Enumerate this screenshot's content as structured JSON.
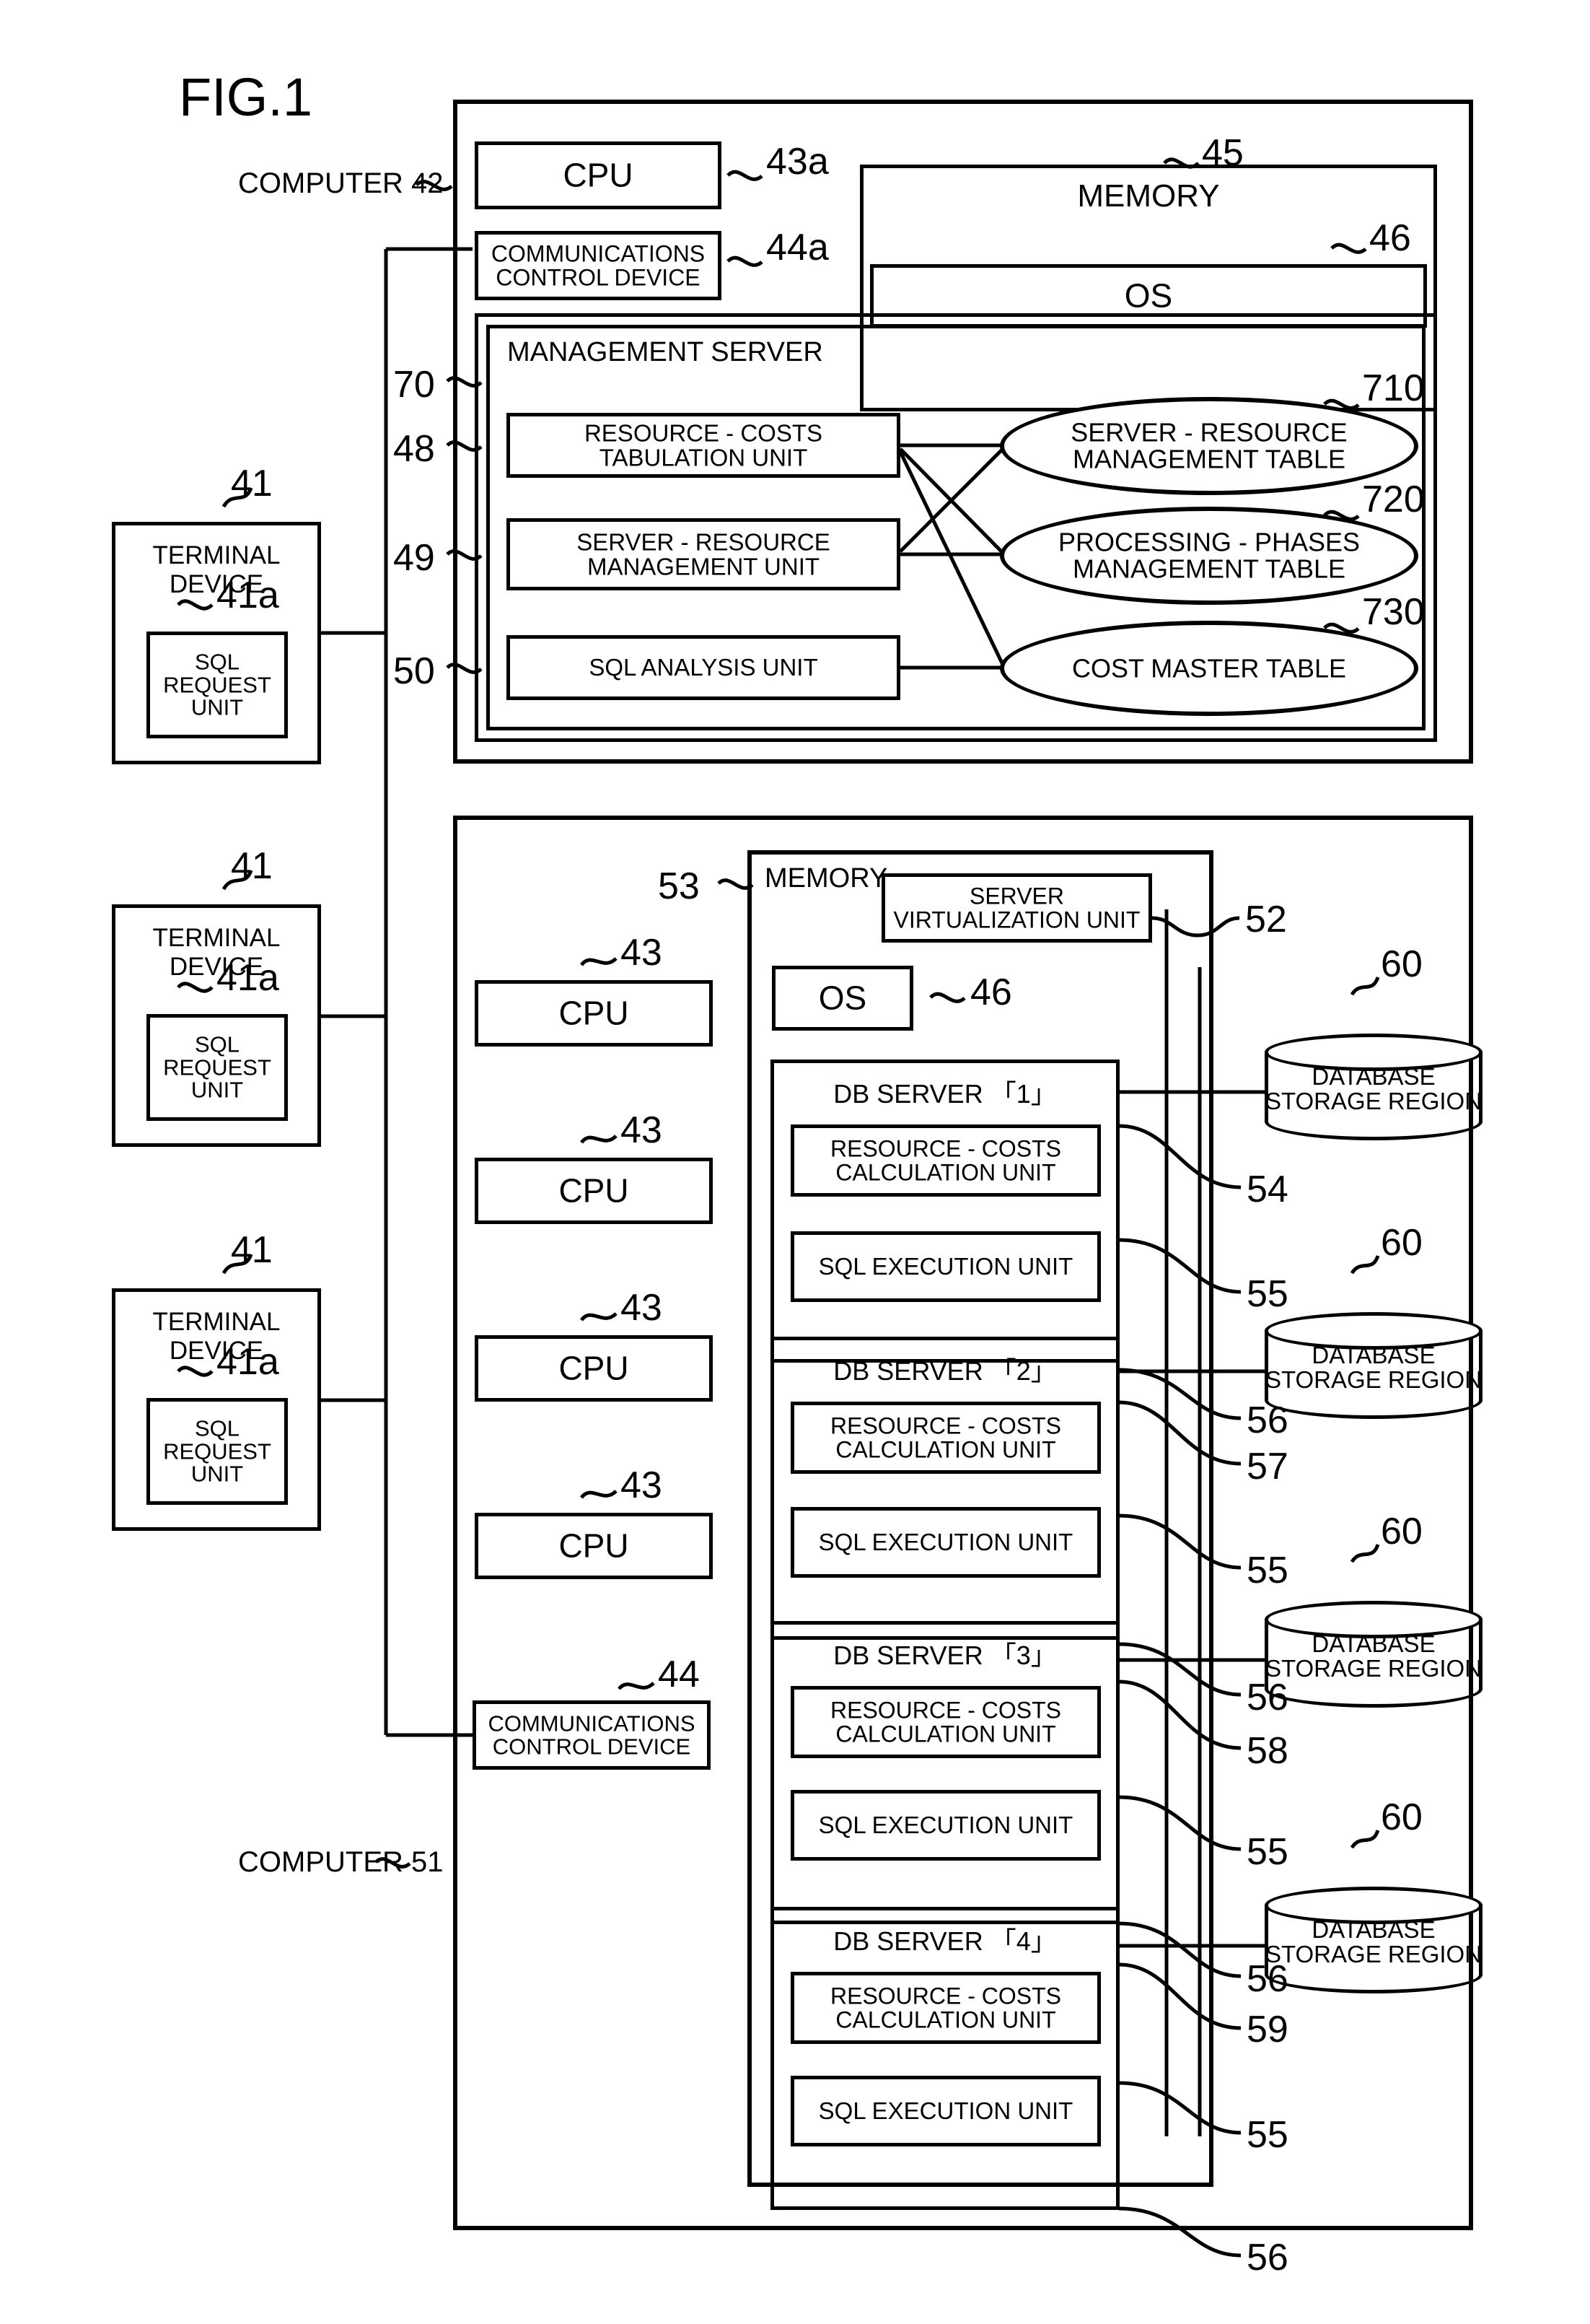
{
  "figure": {
    "title": "FIG.1"
  },
  "labels": {
    "computer_42": "COMPUTER 42",
    "computer_51": "COMPUTER 51"
  },
  "computer42": {
    "cpu": {
      "text": "CPU",
      "ref": "43a"
    },
    "comm": {
      "line1": "COMMUNICATIONS",
      "line2": "CONTROL DEVICE",
      "ref": "44a"
    },
    "memory": {
      "title": "MEMORY",
      "ref": "45"
    },
    "os": {
      "text": "OS",
      "ref": "46"
    },
    "management_server": {
      "title": "MANAGEMENT SERVER",
      "ref": "70",
      "units": [
        {
          "line1": "RESOURCE - COSTS TABULATION UNIT",
          "line2": "",
          "ref": "48"
        },
        {
          "line1": "SERVER - RESOURCE",
          "line2": "MANAGEMENT UNIT",
          "ref": "49"
        },
        {
          "line1": "SQL ANALYSIS UNIT",
          "line2": "",
          "ref": "50"
        }
      ],
      "tables": [
        {
          "line1": "SERVER - RESOURCE",
          "line2": "MANAGEMENT TABLE",
          "ref": "710"
        },
        {
          "line1": "PROCESSING - PHASES",
          "line2": "MANAGEMENT TABLE",
          "ref": "720"
        },
        {
          "line1": "COST MASTER TABLE",
          "line2": "",
          "ref": "730"
        }
      ]
    }
  },
  "terminals": [
    {
      "title": "TERMINAL DEVICE",
      "ref": "41",
      "unit_line1": "SQL",
      "unit_line2": "REQUEST UNIT",
      "unit_ref": "41a"
    },
    {
      "title": "TERMINAL DEVICE",
      "ref": "41",
      "unit_line1": "SQL",
      "unit_line2": "REQUEST UNIT",
      "unit_ref": "41a"
    },
    {
      "title": "TERMINAL DEVICE",
      "ref": "41",
      "unit_line1": "SQL",
      "unit_line2": "REQUEST UNIT",
      "unit_ref": "41a"
    }
  ],
  "computer51": {
    "cpus": [
      {
        "text": "CPU",
        "ref": "43"
      },
      {
        "text": "CPU",
        "ref": "43"
      },
      {
        "text": "CPU",
        "ref": "43"
      },
      {
        "text": "CPU",
        "ref": "43"
      }
    ],
    "comm": {
      "line1": "COMMUNICATIONS",
      "line2": "CONTROL DEVICE",
      "ref": "44"
    },
    "memory": {
      "title": "MEMORY",
      "ref": "53"
    },
    "server_virtualization": {
      "line1": "SERVER",
      "line2": "VIRTUALIZATION UNIT",
      "ref": "52"
    },
    "os": {
      "text": "OS",
      "ref": "46"
    },
    "db_servers": [
      {
        "title": "DB SERVER 「1」",
        "ref": "54",
        "calc_line1": "RESOURCE - COSTS",
        "calc_line2": "CALCULATION UNIT",
        "calc_ref": "55",
        "exec": "SQL EXECUTION UNIT",
        "exec_ref": "56"
      },
      {
        "title": "DB SERVER 「2」",
        "ref": "57",
        "calc_line1": "RESOURCE - COSTS",
        "calc_line2": "CALCULATION UNIT",
        "calc_ref": "55",
        "exec": "SQL EXECUTION UNIT",
        "exec_ref": "56"
      },
      {
        "title": "DB SERVER 「3」",
        "ref": "58",
        "calc_line1": "RESOURCE - COSTS",
        "calc_line2": "CALCULATION UNIT",
        "calc_ref": "55",
        "exec": "SQL EXECUTION UNIT",
        "exec_ref": "56"
      },
      {
        "title": "DB SERVER 「4」",
        "ref": "59",
        "calc_line1": "RESOURCE - COSTS",
        "calc_line2": "CALCULATION UNIT",
        "calc_ref": "55",
        "exec": "SQL EXECUTION UNIT",
        "exec_ref": "56"
      }
    ]
  },
  "storages": [
    {
      "line1": "DATABASE",
      "line2": "STORAGE REGION",
      "ref": "60"
    },
    {
      "line1": "DATABASE",
      "line2": "STORAGE REGION",
      "ref": "60"
    },
    {
      "line1": "DATABASE",
      "line2": "STORAGE REGION",
      "ref": "60"
    },
    {
      "line1": "DATABASE",
      "line2": "STORAGE REGION",
      "ref": "60"
    }
  ],
  "colors": {
    "ink": "#000000",
    "paper": "#ffffff"
  }
}
